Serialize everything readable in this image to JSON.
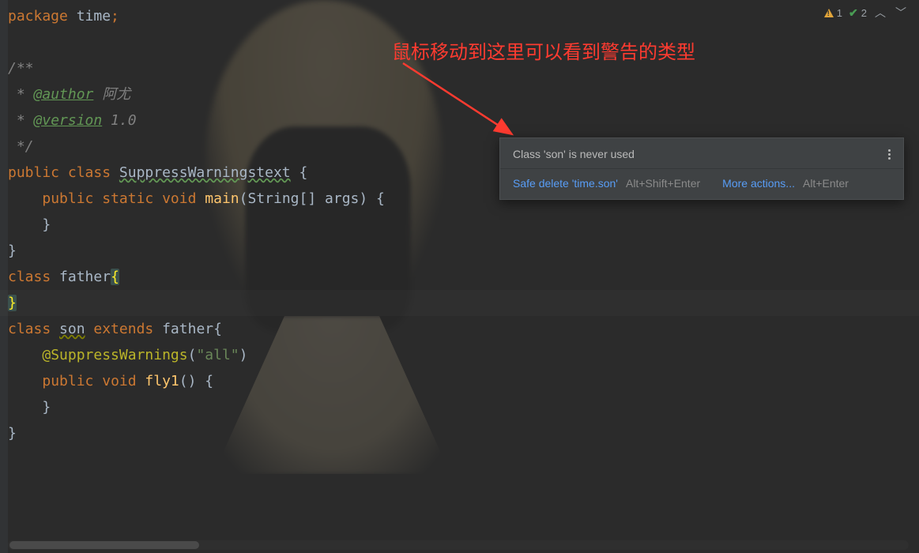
{
  "inspections": {
    "warning_count": "1",
    "ok_count": "2"
  },
  "annotation": {
    "text": "鼠标移动到这里可以看到警告的类型"
  },
  "popup": {
    "message": "Class 'son' is never used",
    "action1": "Safe delete 'time.son'",
    "shortcut1": "Alt+Shift+Enter",
    "action2": "More actions...",
    "shortcut2": "Alt+Enter"
  },
  "code": {
    "l1_kw1": "package",
    "l1_id": " time",
    "l1_semi": ";",
    "l3": "/**",
    "l4_star": " * ",
    "l4_tag": "@author",
    "l4_val": " 阿尤",
    "l5_star": " * ",
    "l5_tag": "@version",
    "l5_val": " 1.0",
    "l6": " */",
    "l7_kw1": "public",
    "l7_kw2": " class ",
    "l7_name": "SuppressWarningstext",
    "l7_sp": " ",
    "l7_brace": "{",
    "l8_indent": "    ",
    "l8_kw1": "public",
    "l8_kw2": " static",
    "l8_kw3": " void ",
    "l8_method": "main",
    "l8_p1": "(",
    "l8_type": "String",
    "l8_arr": "[] args) {",
    "l9": "    }",
    "l10": "}",
    "l11_kw": "class ",
    "l11_name": "father",
    "l11_brace": "{",
    "l12_brace": "}",
    "l13_kw1": "class ",
    "l13_name": "son",
    "l13_kw2": " extends ",
    "l13_super": "father",
    "l13_brace": "{",
    "l14_indent": "    ",
    "l14_annot": "@SuppressWarnings",
    "l14_p1": "(",
    "l14_str": "\"all\"",
    "l14_p2": ")",
    "l15_indent": "    ",
    "l15_kw1": "public",
    "l15_kw2": " void ",
    "l15_method": "fly1",
    "l15_rest": "() {",
    "l16": "    }",
    "l17": "}"
  }
}
